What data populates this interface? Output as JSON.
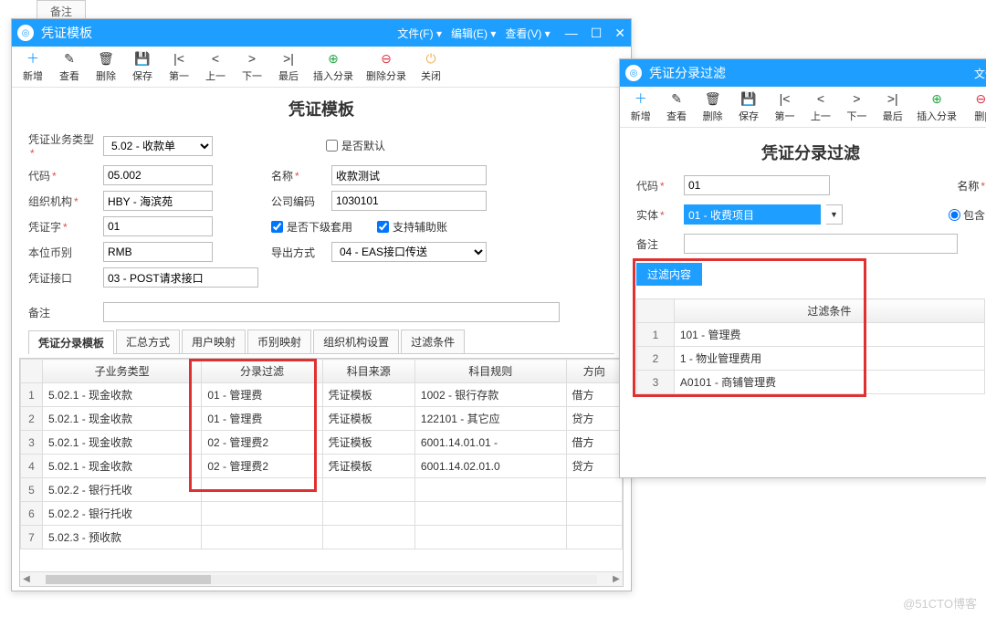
{
  "bg_tab": "备注",
  "watermark": "@51CTO博客",
  "w1": {
    "title": "凭证模板",
    "menus": [
      "文件(F) ▾",
      "编辑(E) ▾",
      "查看(V) ▾"
    ],
    "toolbar": [
      {
        "icon": "＋",
        "label": "新增",
        "cls": "ic-blue"
      },
      {
        "icon": "✎",
        "label": "查看"
      },
      {
        "icon": "🗑",
        "label": "删除"
      },
      {
        "icon": "💾",
        "label": "保存"
      },
      {
        "icon": "|<",
        "label": "第一"
      },
      {
        "icon": "<",
        "label": "上一"
      },
      {
        "icon": ">",
        "label": "下一"
      },
      {
        "icon": ">|",
        "label": "最后"
      },
      {
        "icon": "⊕",
        "label": "插入分录",
        "cls": "ic-green",
        "wide": true
      },
      {
        "icon": "⊖",
        "label": "删除分录",
        "cls": "ic-red",
        "wide": true
      },
      {
        "icon": "⏻",
        "label": "关闭",
        "cls": "ic-orange"
      }
    ],
    "form_title": "凭证模板",
    "form": {
      "biz_type_label": "凭证业务类型",
      "biz_type_value": "5.02 - 收款单",
      "default_label": "是否默认",
      "code_label": "代码",
      "code_value": "05.002",
      "name_label": "名称",
      "name_value": "收款测试",
      "org_label": "组织机构",
      "org_value": "HBY - 海滨苑",
      "company_label": "公司编码",
      "company_value": "1030101",
      "word_label": "凭证字",
      "word_value": "01",
      "sub_enable_label": "是否下级套用",
      "assist_label": "支持辅助账",
      "currency_label": "本位币别",
      "currency_value": "RMB",
      "export_label": "导出方式",
      "export_value": "04 - EAS接口传送",
      "interface_label": "凭证接口",
      "interface_value": "03 - POST请求接口",
      "remark_label": "备注",
      "remark_value": ""
    },
    "tabs": [
      "凭证分录模板",
      "汇总方式",
      "用户映射",
      "币别映射",
      "组织机构设置",
      "过滤条件"
    ],
    "grid_headers": [
      "",
      "子业务类型",
      "分录过滤",
      "科目来源",
      "科目规则",
      "方向"
    ],
    "grid_rows": [
      [
        "1",
        "5.02.1 - 现金收款",
        "01 - 管理费",
        "凭证模板",
        "1002 - 银行存款",
        "借方"
      ],
      [
        "2",
        "5.02.1 - 现金收款",
        "01 - 管理费",
        "凭证模板",
        "122101 - 其它应",
        "贷方"
      ],
      [
        "3",
        "5.02.1 - 现金收款",
        "02 - 管理费2",
        "凭证模板",
        "6001.14.01.01 -",
        "借方"
      ],
      [
        "4",
        "5.02.1 - 现金收款",
        "02 - 管理费2",
        "凭证模板",
        "6001.14.02.01.0",
        "贷方"
      ],
      [
        "5",
        "5.02.2 - 银行托收",
        "",
        "",
        "",
        ""
      ],
      [
        "6",
        "5.02.2 - 银行托收",
        "",
        "",
        "",
        ""
      ],
      [
        "7",
        "5.02.3 - 预收款",
        "",
        "",
        "",
        ""
      ]
    ]
  },
  "w2": {
    "title": "凭证分录过滤",
    "menus": [
      "文件"
    ],
    "toolbar": [
      {
        "icon": "＋",
        "label": "新增",
        "cls": "ic-blue"
      },
      {
        "icon": "✎",
        "label": "查看"
      },
      {
        "icon": "🗑",
        "label": "删除"
      },
      {
        "icon": "💾",
        "label": "保存"
      },
      {
        "icon": "|<",
        "label": "第一"
      },
      {
        "icon": "<",
        "label": "上一"
      },
      {
        "icon": ">",
        "label": "下一"
      },
      {
        "icon": ">|",
        "label": "最后"
      },
      {
        "icon": "⊕",
        "label": "插入分录",
        "cls": "ic-green",
        "wide": true
      },
      {
        "icon": "⊖",
        "label": "删|",
        "cls": "ic-red"
      }
    ],
    "form_title": "凭证分录过滤",
    "form": {
      "code_label": "代码",
      "code_value": "01",
      "name_label": "名称",
      "entity_label": "实体",
      "entity_value": "01 - 收费项目",
      "contain_label": "包含",
      "remark_label": "备注",
      "remark_value": ""
    },
    "filter_tab": "过滤内容",
    "filter_header": "过滤条件",
    "filter_rows": [
      [
        "1",
        "101 - 管理费"
      ],
      [
        "2",
        "1 - 物业管理费用"
      ],
      [
        "3",
        "A0101 - 商铺管理费"
      ]
    ]
  }
}
